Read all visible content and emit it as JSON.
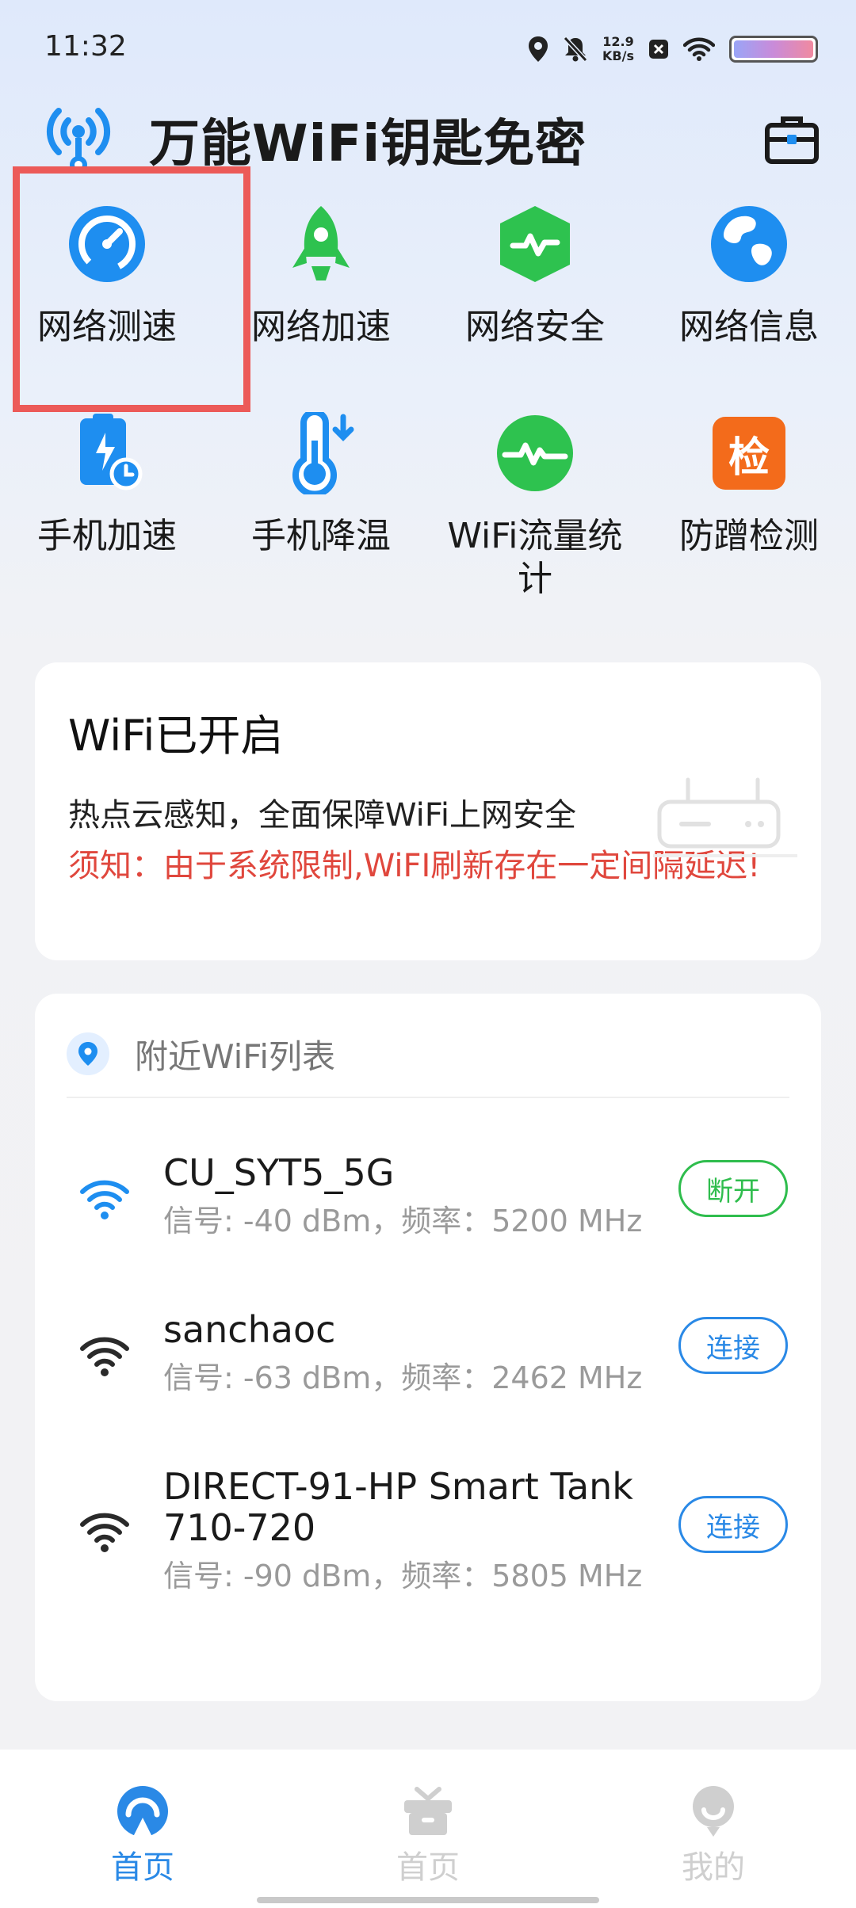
{
  "status_bar": {
    "time": "11:32",
    "net_speed_value": "12.9",
    "net_speed_unit": "KB/s",
    "icons": [
      "location-icon",
      "mute-icon",
      "notification-x-icon",
      "wifi-icon",
      "battery-icon"
    ]
  },
  "header": {
    "title": "万能WiFi钥匙免密",
    "logo_icon": "antenna-icon",
    "toolbox_icon": "toolbox-icon"
  },
  "tools": [
    {
      "label": "网络测速",
      "icon": "speedometer-icon",
      "color": "#1e8ef0"
    },
    {
      "label": "网络加速",
      "icon": "rocket-icon",
      "color": "#2ec24f"
    },
    {
      "label": "网络安全",
      "icon": "shield-pulse-icon",
      "color": "#2ec24f"
    },
    {
      "label": "网络信息",
      "icon": "globe-icon",
      "color": "#1e8ef0"
    },
    {
      "label": "手机加速",
      "icon": "phone-clipboard-icon",
      "color": "#1e8ef0"
    },
    {
      "label": "手机降温",
      "icon": "thermometer-icon",
      "color": "#1e8ef0"
    },
    {
      "label": "WiFi流量统计",
      "icon": "traffic-pulse-icon",
      "color": "#2ec24f"
    },
    {
      "label": "防蹭检测",
      "icon": "check-badge-icon",
      "color": "#f36b1b",
      "badge_text": "检"
    }
  ],
  "highlighted_tool": "网络测速",
  "wifi_status": {
    "title": "WiFi已开启",
    "desc": "热点云感知，全面保障WiFi上网安全",
    "notice": "须知：由于系统限制,WiFI刷新存在一定间隔延迟!"
  },
  "nearby": {
    "title": "附近WiFi列表",
    "networks": [
      {
        "name": "CU_SYT5_5G",
        "meta": "信号: -40 dBm，频率：5200 MHz",
        "action": "断开",
        "connected": true
      },
      {
        "name": "sanchaoc",
        "meta": "信号: -63 dBm，频率：2462 MHz",
        "action": "连接",
        "connected": false
      },
      {
        "name": "DIRECT-91-HP Smart Tank 710-720",
        "meta": "信号: -90 dBm，频率：5805 MHz",
        "action": "连接",
        "connected": false
      }
    ]
  },
  "bottom_nav": [
    {
      "label": "首页",
      "icon": "home-signal-icon",
      "active": true
    },
    {
      "label": "首页",
      "icon": "gift-box-icon",
      "active": false
    },
    {
      "label": "我的",
      "icon": "profile-icon",
      "active": false
    }
  ],
  "colors": {
    "accent_blue": "#2a89e6",
    "accent_green": "#2fbd4d",
    "warning_red": "#e0473d",
    "highlight_red": "#ec5a58"
  }
}
